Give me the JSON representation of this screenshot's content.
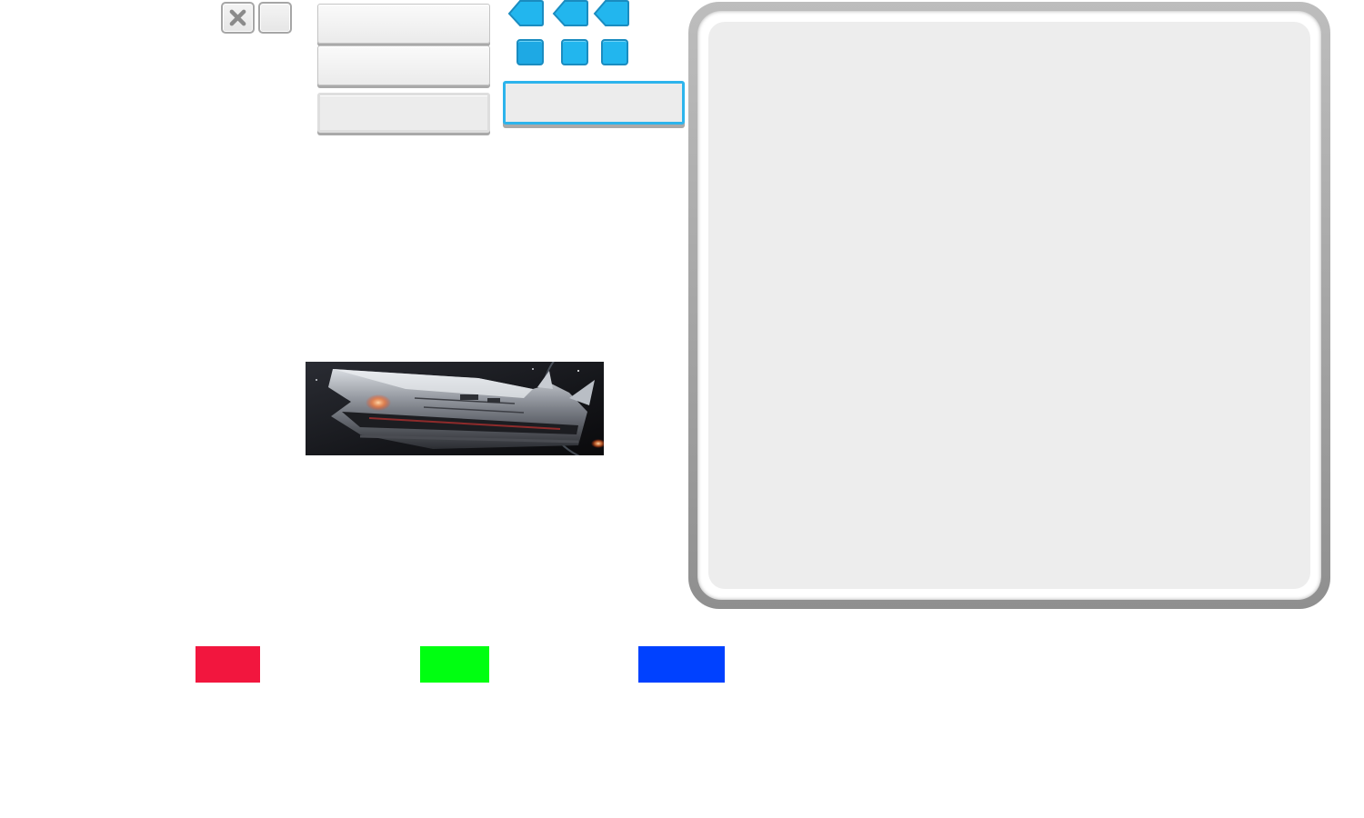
{
  "icons": {
    "close": "close-x-icon",
    "arrow": "arrow-left-icon",
    "banner": "spaceship-banner"
  },
  "input": {
    "value": "",
    "placeholder": ""
  },
  "colors": {
    "accent_blue": "#22b6ee",
    "panel_bg": "#ededed",
    "button_gray": "#ececec"
  },
  "swatches": [
    {
      "name": "red",
      "color": "#f2163e"
    },
    {
      "name": "green",
      "color": "#00ff11"
    },
    {
      "name": "blue",
      "color": "#0041ff"
    }
  ]
}
